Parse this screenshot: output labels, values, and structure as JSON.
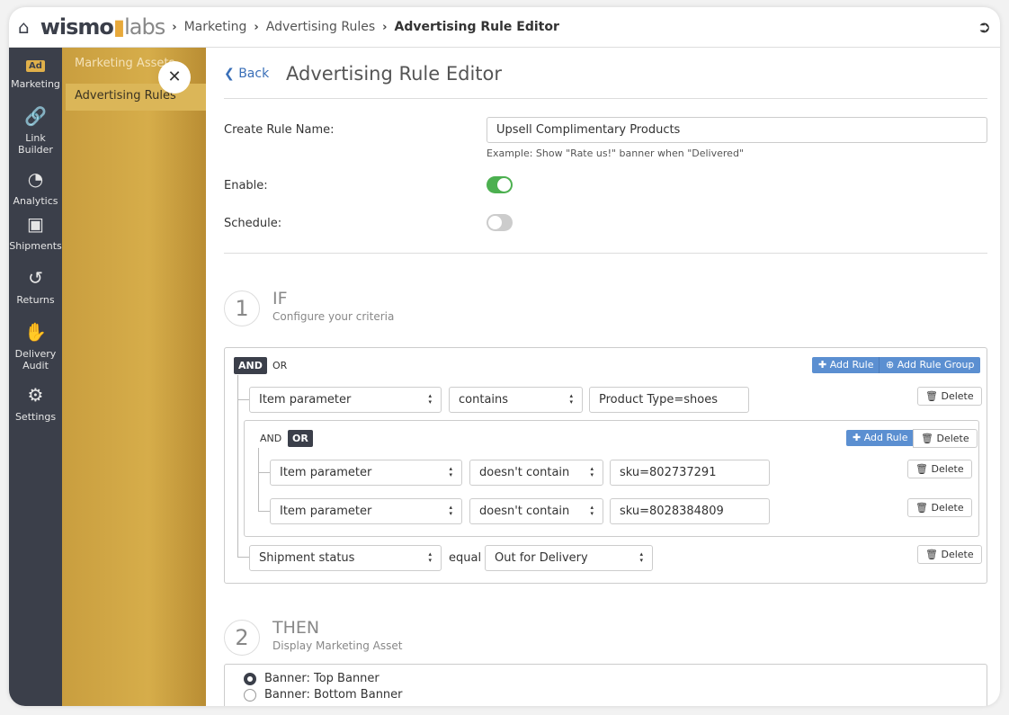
{
  "header": {
    "logo_text": "wismo labs",
    "breadcrumb": [
      "Marketing",
      "Advertising Rules",
      "Advertising Rule Editor"
    ]
  },
  "sidebar": {
    "items": [
      {
        "icon": "ad-icon",
        "label": "Marketing"
      },
      {
        "icon": "link-icon",
        "label": "Link Builder"
      },
      {
        "icon": "pie-chart-icon",
        "label": "Analytics"
      },
      {
        "icon": "box-icon",
        "label": "Shipments"
      },
      {
        "icon": "undo-icon",
        "label": "Returns"
      },
      {
        "icon": "hand-icon",
        "label": "Delivery Audit"
      },
      {
        "icon": "gears-icon",
        "label": "Settings"
      }
    ]
  },
  "submenu": {
    "items": [
      "Marketing Assets",
      "Advertising Rules"
    ],
    "active": "Advertising Rules"
  },
  "page": {
    "back": "Back",
    "title": "Advertising Rule Editor"
  },
  "form": {
    "name_label": "Create Rule Name:",
    "name_value": "Upsell Complimentary Products",
    "name_hint": "Example: Show \"Rate us!\" banner when \"Delivered\"",
    "enable_label": "Enable:",
    "enable": true,
    "schedule_label": "Schedule:",
    "schedule": false
  },
  "if": {
    "num": "1",
    "title": "IF",
    "subtitle": "Configure your criteria",
    "and": "AND",
    "or": "OR",
    "active": "AND",
    "add_rule": "Add Rule",
    "add_group": "Add Rule Group",
    "delete": "Delete",
    "rule1": {
      "param": "Item parameter",
      "op": "contains",
      "value": "Product Type=shoes"
    },
    "group": {
      "and": "AND",
      "or": "OR",
      "active": "OR",
      "add_rule": "Add Rule",
      "delete": "Delete",
      "rules": [
        {
          "param": "Item parameter",
          "op": "doesn't contain",
          "value": "sku=802737291"
        },
        {
          "param": "Item parameter",
          "op": "doesn't contain",
          "value": "sku=8028384809"
        }
      ]
    },
    "rule3": {
      "param": "Shipment status",
      "op": "equal",
      "value": "Out for Delivery"
    }
  },
  "then": {
    "num": "2",
    "title": "THEN",
    "subtitle": "Display Marketing Asset",
    "options": [
      "Banner: Top Banner",
      "Banner: Bottom Banner"
    ],
    "selected": "Banner: Top Banner"
  },
  "colors": {
    "sidebar": "#3b3f4a",
    "accent": "#5b8fd1",
    "gold": "#c99e3f",
    "toggle_on": "#4cb050"
  }
}
